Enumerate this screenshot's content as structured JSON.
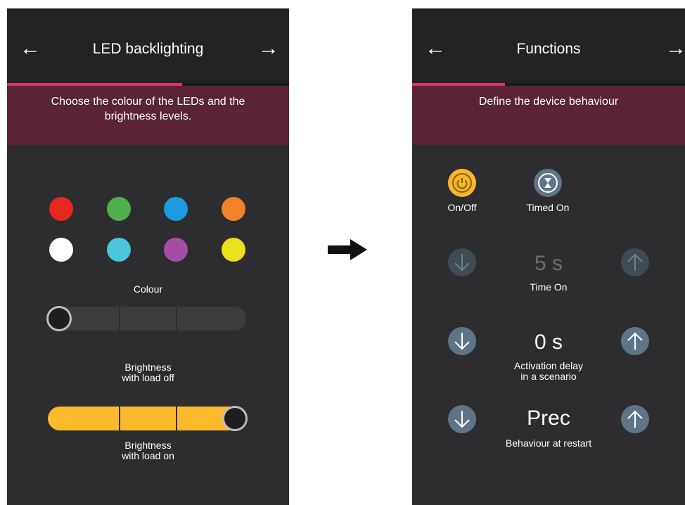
{
  "left_screen": {
    "title": "LED backlighting",
    "instruction": "Choose the colour of the LEDs and the brightness levels.",
    "progress_fraction": 0.62,
    "colours": [
      {
        "name": "red",
        "hex": "#e8271f"
      },
      {
        "name": "green",
        "hex": "#4cb14a"
      },
      {
        "name": "blue",
        "hex": "#1e9be0"
      },
      {
        "name": "orange",
        "hex": "#f0822a"
      },
      {
        "name": "white",
        "hex": "#ffffff"
      },
      {
        "name": "cyan",
        "hex": "#4cc6dc"
      },
      {
        "name": "purple",
        "hex": "#a64ea6"
      },
      {
        "name": "yellow",
        "hex": "#e9e21c"
      }
    ],
    "colour_label": "Colour",
    "brightness_off": {
      "label_line1": "Brightness",
      "label_line2": "with load off",
      "level": 0
    },
    "brightness_on": {
      "label_line1": "Brightness",
      "label_line2": "with load on",
      "level": 1
    }
  },
  "right_screen": {
    "title": "Functions",
    "instruction": "Define the device behaviour",
    "progress_fraction": 0.34,
    "functions": [
      {
        "label": "On/Off",
        "icon": "power-icon",
        "selected": true
      },
      {
        "label": "Timed On",
        "icon": "hourglass-icon",
        "selected": false
      }
    ],
    "time_on": {
      "value": "5 s",
      "label": "Time On",
      "enabled": false
    },
    "activation_delay": {
      "value": "0 s",
      "label_line1": "Activation delay",
      "label_line2": "in a scenario"
    },
    "behaviour_restart": {
      "value": "Prec",
      "label": "Behaviour at restart"
    }
  },
  "colors": {
    "accent": "#d3365f",
    "banner": "#5a2336",
    "selected_icon": "#f5b730",
    "button": "#5f7586",
    "slider_on": "#fcb92c",
    "slider_off": "#3c3c3f"
  }
}
